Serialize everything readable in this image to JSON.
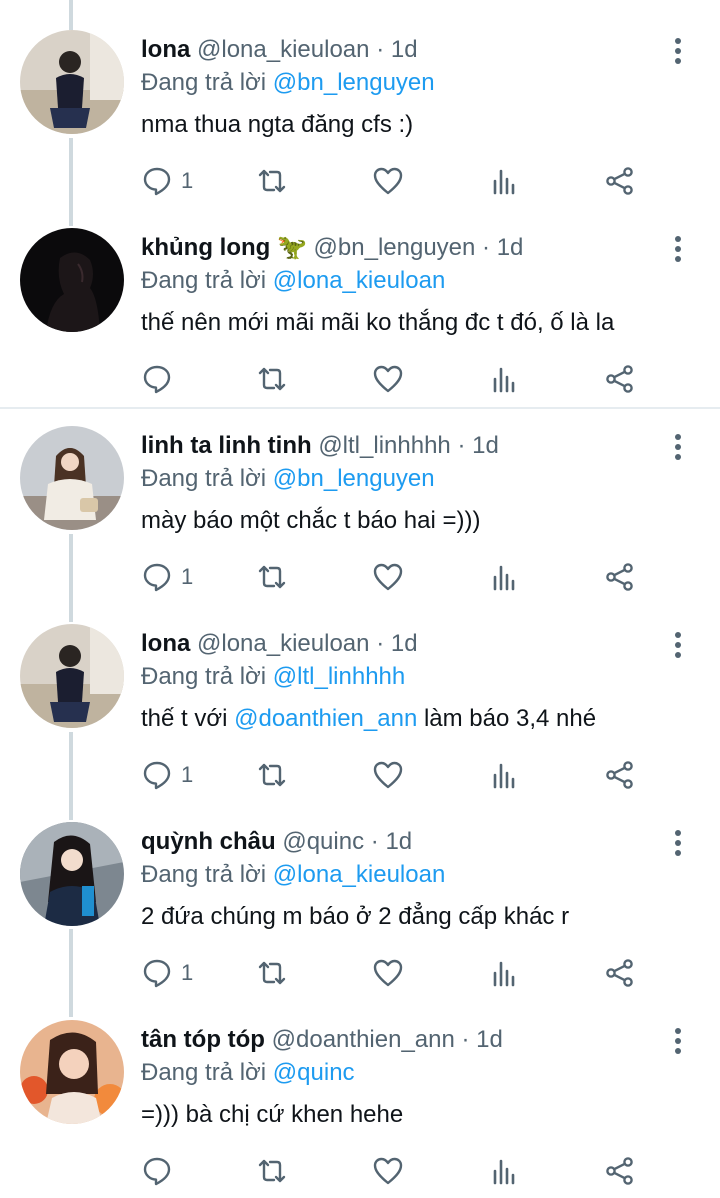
{
  "reply_prefix": "Đang trả lời",
  "colors": {
    "text": "#0f1419",
    "muted": "#536471",
    "accent": "#1d9bf0",
    "thread_line": "#cfd9de"
  },
  "tweets": [
    {
      "name": "lona",
      "handle": "@lona_kieuloan",
      "dot": "·",
      "time": "1d",
      "reply_to": "@bn_lenguyen",
      "text": "nma thua ngta đăng cfs :)",
      "reply_count": "1",
      "avatar": "avatar-lona"
    },
    {
      "name": "khủng long 🦖",
      "handle": "@bn_lenguyen",
      "dot": "·",
      "time": "1d",
      "reply_to": "@lona_kieuloan",
      "text": "thế nên mới mãi mãi ko thắng đc t đó, ố là la",
      "reply_count": "",
      "avatar": "avatar-silhouette"
    },
    {
      "name": "linh ta linh tinh",
      "handle": "@ltl_linhhhh",
      "dot": "·",
      "time": "1d",
      "reply_to": "@bn_lenguyen",
      "text": "mày báo một chắc t báo hai =)))",
      "reply_count": "1",
      "avatar": "avatar-linh"
    },
    {
      "name": "lona",
      "handle": "@lona_kieuloan",
      "dot": "·",
      "time": "1d",
      "reply_to": "@ltl_linhhhh",
      "text_before": "thế t với ",
      "text_mention": "@doanthien_ann",
      "text_after": " làm báo 3,4 nhé",
      "reply_count": "1",
      "avatar": "avatar-lona"
    },
    {
      "name": "quỳnh châu",
      "handle": "@quinc",
      "dot": "·",
      "time": "1d",
      "reply_to": "@lona_kieuloan",
      "text": "2 đứa chúng m báo ở 2 đẳng cấp khác r",
      "reply_count": "1",
      "avatar": "avatar-quynh"
    },
    {
      "name": "tân tóp tóp",
      "handle": "@doanthien_ann",
      "dot": "·",
      "time": "1d",
      "reply_to": "@quinc",
      "text": "=))) bà chị cứ khen hehe",
      "reply_count": "",
      "avatar": "avatar-tan"
    }
  ]
}
